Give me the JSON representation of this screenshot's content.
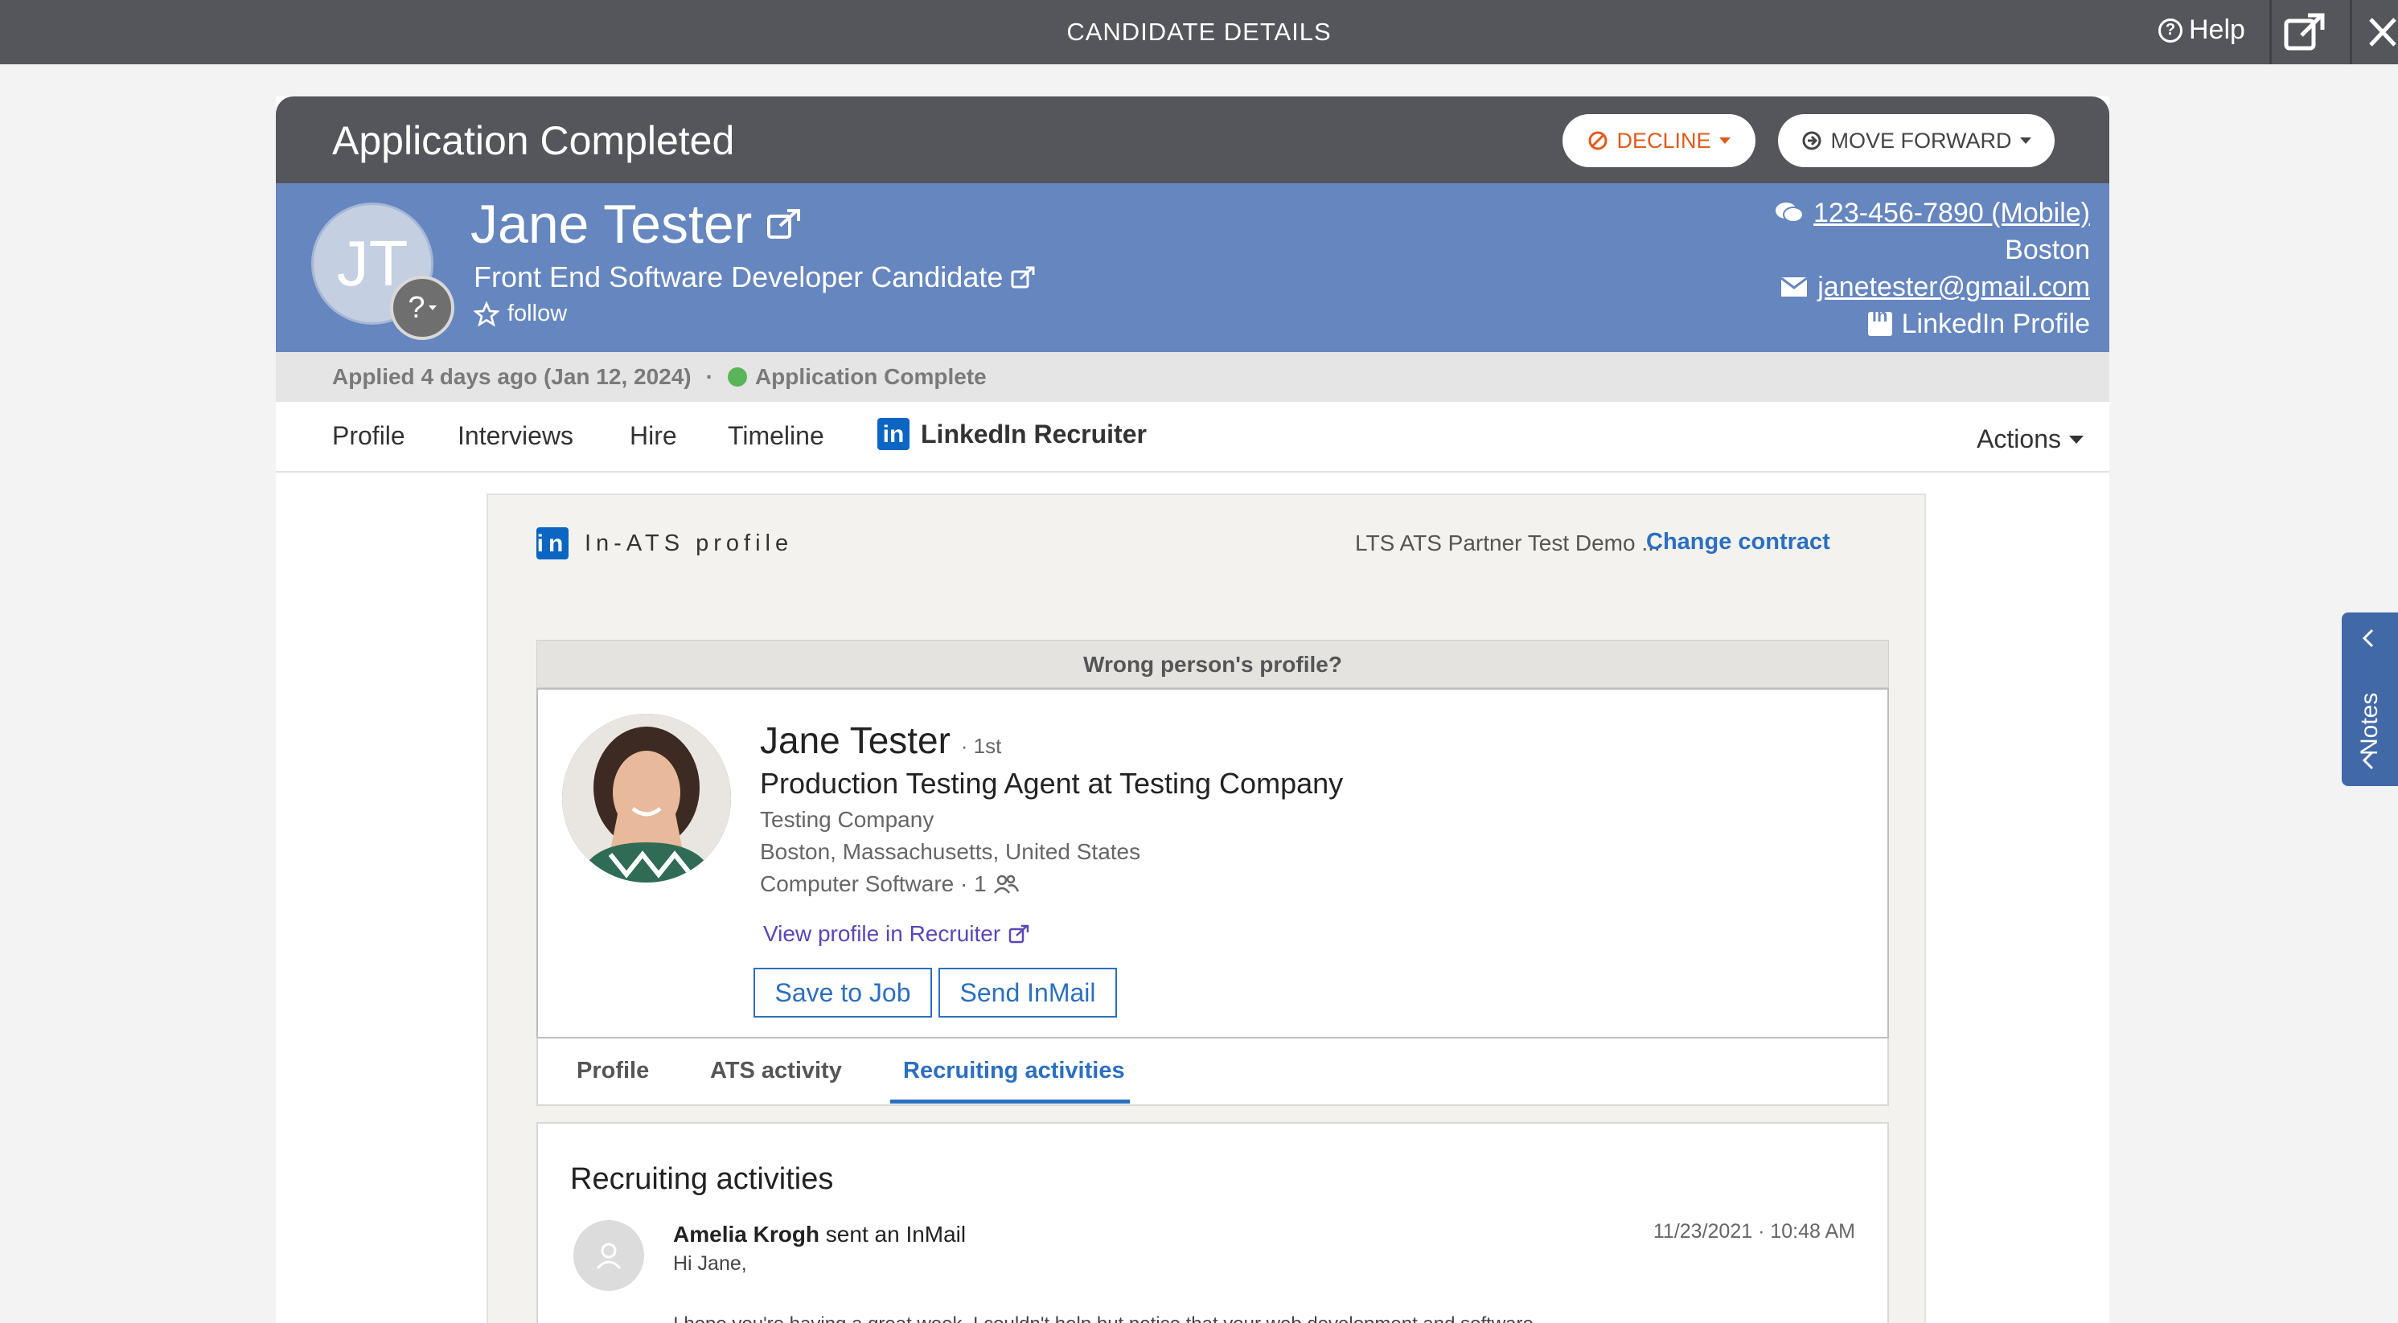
{
  "topbar": {
    "title": "CANDIDATE DETAILS",
    "help_label": "Help"
  },
  "header": {
    "status": "Application Completed",
    "decline_label": "DECLINE",
    "move_forward_label": "MOVE FORWARD"
  },
  "candidate": {
    "initials": "JT",
    "badge": "?",
    "name": "Jane Tester",
    "role": "Front End Software Developer Candidate",
    "follow_label": "follow",
    "phone": "123-456-7890 (Mobile)",
    "city": "Boston",
    "email": "janetester@gmail.com",
    "linkedin_label": "LinkedIn Profile"
  },
  "application": {
    "applied": "Applied 4 days ago (Jan 12, 2024)",
    "separator": "·",
    "status": "Application Complete"
  },
  "tabs": {
    "profile": "Profile",
    "interviews": "Interviews",
    "hire": "Hire",
    "timeline": "Timeline",
    "linkedin": "LinkedIn Recruiter",
    "actions": "Actions"
  },
  "linkedin_panel": {
    "header": "In-ATS profile",
    "contract": "LTS ATS Partner Test Demo ...",
    "change_contract": "Change contract",
    "wrong_person": "Wrong person's profile?",
    "profile": {
      "name": "Jane Tester",
      "degree": "· 1st",
      "headline": "Production Testing Agent at Testing Company",
      "company": "Testing Company",
      "location": "Boston, Massachusetts, United States",
      "industry": "Computer Software · 1",
      "view_link": "View profile in Recruiter",
      "save_button": "Save to Job",
      "inmail_button": "Send InMail"
    },
    "subtabs": {
      "profile": "Profile",
      "ats_activity": "ATS activity",
      "recruiting": "Recruiting activities"
    },
    "activities": {
      "title": "Recruiting activities",
      "sender": "Amelia Krogh",
      "action": " sent an InMail",
      "timestamp": "11/23/2021 · 10:48 AM",
      "greeting": "Hi Jane,",
      "body": "I hope you're having a great week. I couldn't help but notice that your web development and software"
    }
  },
  "notes_tab": {
    "label": "Notes"
  },
  "colors": {
    "topbar": "#54565b",
    "candidate_band": "#6586be",
    "decline": "#e05a1b",
    "link_blue": "#2b6fc0",
    "status_green": "#5ab55a"
  }
}
